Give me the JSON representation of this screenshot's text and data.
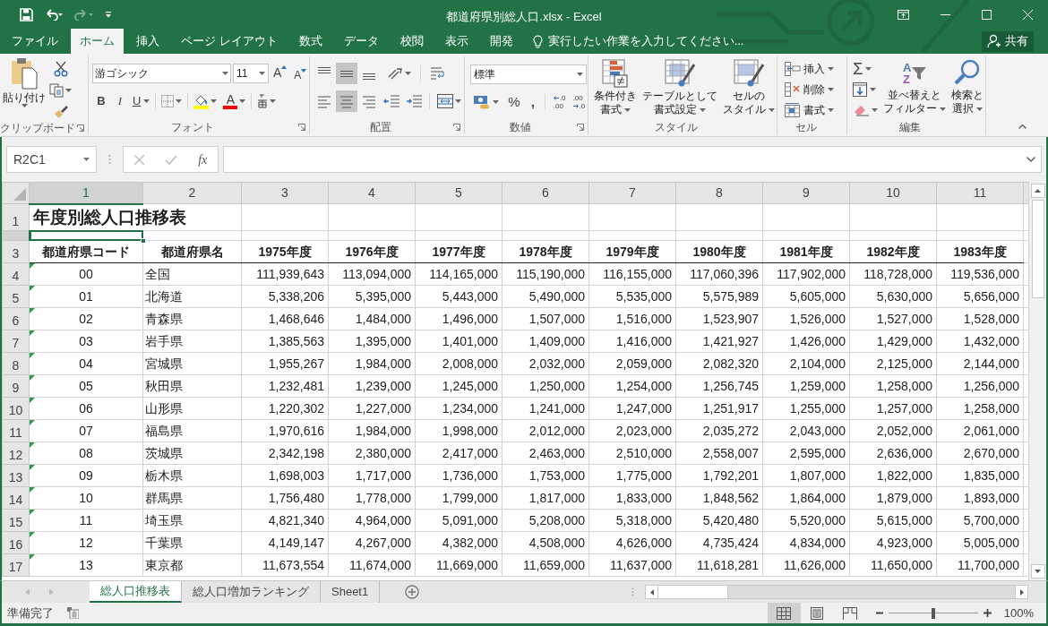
{
  "window": {
    "title": "都道府県別総人口.xlsx - Excel"
  },
  "quick_access": {
    "redo": {
      "disabled": true
    }
  },
  "ribbon_tabs": [
    {
      "label": "ファイル",
      "selected": false
    },
    {
      "label": "ホーム",
      "selected": true
    },
    {
      "label": "挿入",
      "selected": false
    },
    {
      "label": "ページ レイアウト",
      "selected": false
    },
    {
      "label": "数式",
      "selected": false
    },
    {
      "label": "データ",
      "selected": false
    },
    {
      "label": "校閲",
      "selected": false
    },
    {
      "label": "表示",
      "selected": false
    },
    {
      "label": "開発",
      "selected": false
    }
  ],
  "tell_me": {
    "placeholder": "実行したい作業を入力してください..."
  },
  "share": "共有",
  "ribbon": {
    "clipboard": {
      "paste": "貼り付け",
      "label": "クリップボード"
    },
    "font": {
      "name": "游ゴシック",
      "size": "11",
      "grow": "A",
      "shrink": "A",
      "bold": "B",
      "italic": "I",
      "underline": "U",
      "font_color": "A",
      "label": "フォント"
    },
    "alignment": {
      "vertical_buttons": [
        {
          "selected": false
        },
        {
          "selected": true
        },
        {
          "selected": false
        }
      ],
      "horizontal_buttons": [
        {
          "selected": false
        },
        {
          "selected": true
        },
        {
          "selected": false
        }
      ],
      "label": "配置"
    },
    "number": {
      "format": "標準",
      "percent": "%",
      "comma": ",",
      "decimal_buttons": [
        {
          "top": ".0",
          "bottom": ".00"
        },
        {
          "top": ".00",
          "bottom": ".0"
        }
      ],
      "label": "数値"
    },
    "styles": {
      "buttons": [
        {
          "kind": "conditional",
          "lines": [
            "条件付き",
            "書式"
          ]
        },
        {
          "kind": "table",
          "lines": [
            "テーブルとして",
            "書式設定"
          ]
        },
        {
          "kind": "cell",
          "lines": [
            "セルの",
            "スタイル"
          ]
        }
      ],
      "label": "スタイル"
    },
    "cells": {
      "buttons": [
        {
          "kind": "insert",
          "label": "挿入"
        },
        {
          "kind": "delete",
          "label": "削除"
        },
        {
          "kind": "format",
          "label": "書式"
        }
      ],
      "label": "セル"
    },
    "editing": {
      "sum": "Σ",
      "sort": {
        "letters": [
          "A",
          "Z"
        ],
        "lines": [
          "並べ替えと",
          "フィルター"
        ]
      },
      "find": {
        "lines": [
          "検索と",
          "選択"
        ]
      },
      "label": "編集"
    }
  },
  "formula_bar": {
    "name_box": "R2C1",
    "fx": "fx"
  },
  "sheet": {
    "column_headers": [
      {
        "label": "1",
        "selected": true
      },
      {
        "label": "2",
        "selected": false
      },
      {
        "label": "3",
        "selected": false
      },
      {
        "label": "4",
        "selected": false
      },
      {
        "label": "5",
        "selected": false
      },
      {
        "label": "6",
        "selected": false
      },
      {
        "label": "7",
        "selected": false
      },
      {
        "label": "8",
        "selected": false
      },
      {
        "label": "9",
        "selected": false
      },
      {
        "label": "10",
        "selected": false
      },
      {
        "label": "11",
        "selected": false
      }
    ],
    "row_headers": [
      {
        "label": "1",
        "selected": false
      },
      {
        "selected": true
      },
      {
        "label": "3",
        "selected": false
      },
      {
        "label": "4",
        "selected": false
      },
      {
        "label": "5",
        "selected": false
      },
      {
        "label": "6",
        "selected": false
      },
      {
        "label": "7",
        "selected": false
      },
      {
        "label": "8",
        "selected": false
      },
      {
        "label": "9",
        "selected": false
      },
      {
        "label": "10",
        "selected": false
      },
      {
        "label": "11",
        "selected": false
      },
      {
        "label": "12",
        "selected": false
      },
      {
        "label": "13",
        "selected": false
      },
      {
        "label": "14",
        "selected": false
      },
      {
        "label": "15",
        "selected": false
      },
      {
        "label": "16",
        "selected": false
      },
      {
        "label": "17",
        "selected": false
      }
    ],
    "title": "年度別総人口推移表",
    "header": [
      "都道府県コード",
      "都道府県名",
      "1975年度",
      "1976年度",
      "1977年度",
      "1978年度",
      "1979年度",
      "1980年度",
      "1981年度",
      "1982年度",
      "1983年度"
    ],
    "rows": [
      {
        "flagged": true,
        "cells": [
          "00",
          "全国",
          "111,939,643",
          "113,094,000",
          "114,165,000",
          "115,190,000",
          "116,155,000",
          "117,060,396",
          "117,902,000",
          "118,728,000",
          "119,536,000"
        ]
      },
      {
        "flagged": true,
        "cells": [
          "01",
          "北海道",
          "5,338,206",
          "5,395,000",
          "5,443,000",
          "5,490,000",
          "5,535,000",
          "5,575,989",
          "5,605,000",
          "5,630,000",
          "5,656,000"
        ]
      },
      {
        "flagged": true,
        "cells": [
          "02",
          "青森県",
          "1,468,646",
          "1,484,000",
          "1,496,000",
          "1,507,000",
          "1,516,000",
          "1,523,907",
          "1,526,000",
          "1,527,000",
          "1,528,000"
        ]
      },
      {
        "flagged": true,
        "cells": [
          "03",
          "岩手県",
          "1,385,563",
          "1,395,000",
          "1,401,000",
          "1,409,000",
          "1,416,000",
          "1,421,927",
          "1,426,000",
          "1,429,000",
          "1,432,000"
        ]
      },
      {
        "flagged": true,
        "cells": [
          "04",
          "宮城県",
          "1,955,267",
          "1,984,000",
          "2,008,000",
          "2,032,000",
          "2,059,000",
          "2,082,320",
          "2,104,000",
          "2,125,000",
          "2,144,000"
        ]
      },
      {
        "flagged": true,
        "cells": [
          "05",
          "秋田県",
          "1,232,481",
          "1,239,000",
          "1,245,000",
          "1,250,000",
          "1,254,000",
          "1,256,745",
          "1,259,000",
          "1,258,000",
          "1,256,000"
        ]
      },
      {
        "flagged": true,
        "cells": [
          "06",
          "山形県",
          "1,220,302",
          "1,227,000",
          "1,234,000",
          "1,241,000",
          "1,247,000",
          "1,251,917",
          "1,255,000",
          "1,257,000",
          "1,258,000"
        ]
      },
      {
        "flagged": true,
        "cells": [
          "07",
          "福島県",
          "1,970,616",
          "1,984,000",
          "1,998,000",
          "2,012,000",
          "2,023,000",
          "2,035,272",
          "2,043,000",
          "2,052,000",
          "2,061,000"
        ]
      },
      {
        "flagged": true,
        "cells": [
          "08",
          "茨城県",
          "2,342,198",
          "2,380,000",
          "2,417,000",
          "2,463,000",
          "2,510,000",
          "2,558,007",
          "2,595,000",
          "2,636,000",
          "2,670,000"
        ]
      },
      {
        "flagged": true,
        "cells": [
          "09",
          "栃木県",
          "1,698,003",
          "1,717,000",
          "1,736,000",
          "1,753,000",
          "1,775,000",
          "1,792,201",
          "1,807,000",
          "1,822,000",
          "1,835,000"
        ]
      },
      {
        "flagged": true,
        "cells": [
          "10",
          "群馬県",
          "1,756,480",
          "1,778,000",
          "1,799,000",
          "1,817,000",
          "1,833,000",
          "1,848,562",
          "1,864,000",
          "1,879,000",
          "1,893,000"
        ]
      },
      {
        "flagged": true,
        "cells": [
          "11",
          "埼玉県",
          "4,821,340",
          "4,964,000",
          "5,091,000",
          "5,208,000",
          "5,318,000",
          "5,420,480",
          "5,520,000",
          "5,615,000",
          "5,700,000"
        ]
      },
      {
        "flagged": true,
        "cells": [
          "12",
          "千葉県",
          "4,149,147",
          "4,267,000",
          "4,382,000",
          "4,508,000",
          "4,626,000",
          "4,735,424",
          "4,834,000",
          "4,923,000",
          "5,005,000"
        ]
      },
      {
        "flagged": true,
        "cells": [
          "13",
          "東京都",
          "11,673,554",
          "11,674,000",
          "11,669,000",
          "11,659,000",
          "11,637,000",
          "11,618,281",
          "11,626,000",
          "11,650,000",
          "11,700,000"
        ]
      }
    ]
  },
  "sheet_tabs": [
    {
      "label": "総人口推移表",
      "selected": true
    },
    {
      "label": "総人口増加ランキング",
      "selected": false
    },
    {
      "label": "Sheet1",
      "selected": false
    }
  ],
  "status_bar": {
    "status": "準備完了",
    "views": [
      {
        "kind": "normal",
        "selected": true
      },
      {
        "kind": "page_layout",
        "selected": false
      },
      {
        "kind": "page_break",
        "selected": false
      }
    ],
    "zoom": {
      "level": 0.5,
      "reading": "100%"
    }
  }
}
